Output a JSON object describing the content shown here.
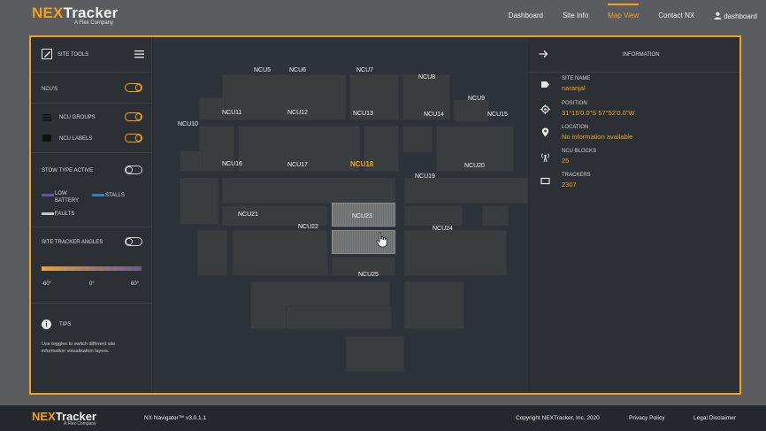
{
  "header": {
    "logo_nex": "NEX",
    "logo_tracker": "Tracker",
    "logo_sub": "A Flex Company",
    "nav": [
      {
        "label": "Dashboard",
        "active": false
      },
      {
        "label": "Site Info",
        "active": false
      },
      {
        "label": "Map View",
        "active": true
      },
      {
        "label": "Contact NX",
        "active": false
      }
    ],
    "user_label": "dashboard"
  },
  "left_panel": {
    "title": "SITE TOOLS",
    "ncus_label": "NCU'S",
    "ncus_on": true,
    "ncu_groups_label": "NCU GROUPS",
    "ncu_groups_on": true,
    "ncu_labels_label": "NCU LABELS",
    "ncu_labels_on": true,
    "stow_label": "STOW TYPE ACTIVE",
    "stow_on": false,
    "legend": {
      "low_battery": "LOW BATTERY",
      "stalls": "STALLS",
      "faults": "FAULTS",
      "low_battery_color": "#6b4fa8",
      "stalls_color": "#2f7fc0",
      "faults_color": "#c8c8c8"
    },
    "angles_label": "SITE TRACKER ANGLES",
    "angles_on": false,
    "angle_min": "-60°",
    "angle_mid": "0°",
    "angle_max": "60°",
    "tips_title": "TIPS",
    "tips_text": "Use toggles to switch different site information visualisation layers."
  },
  "map": {
    "selected": "NCU18",
    "labels": [
      "NCU5",
      "NCU6",
      "NCU7",
      "NCU8",
      "NCU9",
      "NCU10",
      "NCU11",
      "NCU12",
      "NCU13",
      "NCU14",
      "NCU15",
      "NCU16",
      "NCU17",
      "NCU18",
      "NCU19",
      "NCU20",
      "NCU21",
      "NCU22",
      "NCU23",
      "NCU24",
      "NCU25"
    ]
  },
  "right_panel": {
    "title": "INFORMATION",
    "site_name_label": "SITE NAME",
    "site_name": "naranjal",
    "position_label": "POSITION",
    "position": "31°15'0.0\"S 57°52'0.0\"W",
    "location_label": "LOCATION",
    "location": "No information available",
    "ncu_blocks_label": "NCU BLOCKS",
    "ncu_blocks": "25",
    "trackers_label": "TRACKERS",
    "trackers": "2307"
  },
  "footer": {
    "logo_nex": "NEX",
    "logo_tracker": "Tracker",
    "logo_sub": "A Flex Company",
    "version": "NX Navigator™ v3.0.1.1",
    "copyright": "Copyright NEXTracker, Inc. 2020",
    "privacy": "Privacy Policy",
    "legal": "Legal Disclaimer"
  },
  "colors": {
    "accent": "#f0a31a",
    "panel": "#2c3035",
    "map_bg": "#2e333a"
  }
}
